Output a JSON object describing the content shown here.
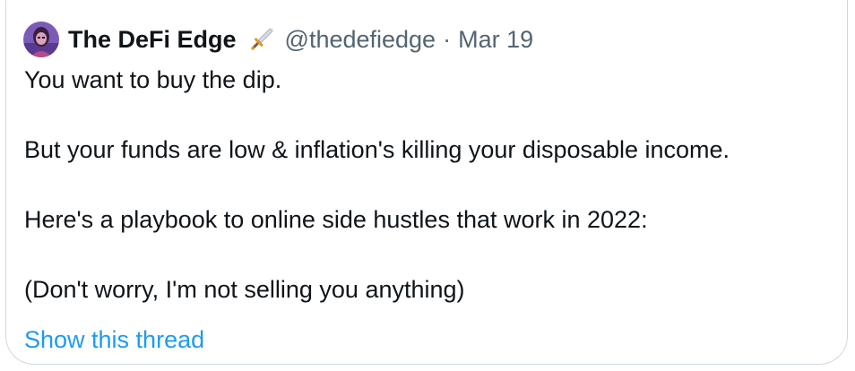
{
  "tweet": {
    "author_name": "The DeFi Edge",
    "badge_icon": "dagger-icon",
    "handle": "@thedefiedge",
    "separator": "·",
    "date": "Mar 19",
    "lines": [
      "You want to buy the dip.",
      "",
      "But your funds are low & inflation's killing your disposable income.",
      "",
      "Here's a playbook to online side hustles that work in 2022:",
      "",
      "(Don't worry, I'm not selling you anything)"
    ],
    "show_thread_label": "Show this thread"
  },
  "colors": {
    "text_primary": "#0f1419",
    "text_secondary": "#536471",
    "link": "#1d9bf0",
    "border": "#cfd9de"
  }
}
